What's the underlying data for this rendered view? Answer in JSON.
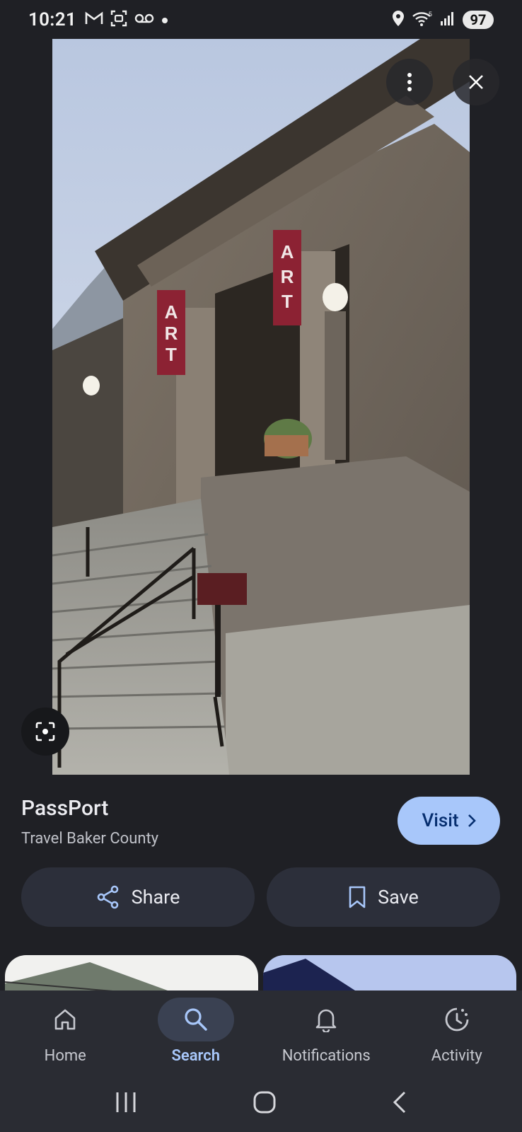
{
  "status_bar": {
    "time": "10:21",
    "battery": "97",
    "icons_left": [
      "gmail-icon",
      "screenshot-icon",
      "voicemail-icon",
      "dot-icon"
    ],
    "icons_right": [
      "location-icon",
      "wifi-icon",
      "signal-icon",
      "battery-icon"
    ]
  },
  "photo": {
    "banner_text": "ART",
    "menu_icon": "more-vert-icon",
    "close_icon": "close-icon",
    "lens_icon": "lens-icon"
  },
  "result": {
    "title": "PassPort",
    "source": "Travel Baker County",
    "visit_label": "Visit"
  },
  "actions": {
    "share_label": "Share",
    "save_label": "Save"
  },
  "bottom_nav": {
    "items": [
      {
        "label": "Home",
        "icon": "home-icon"
      },
      {
        "label": "Search",
        "icon": "search-icon"
      },
      {
        "label": "Notifications",
        "icon": "bell-icon"
      },
      {
        "label": "Activity",
        "icon": "activity-icon"
      }
    ],
    "active": "Search"
  },
  "colors": {
    "background": "#1f2025",
    "accent": "#a8c7fa",
    "button_bg": "#2c2f3a",
    "nav_bg": "#2a2c33"
  }
}
